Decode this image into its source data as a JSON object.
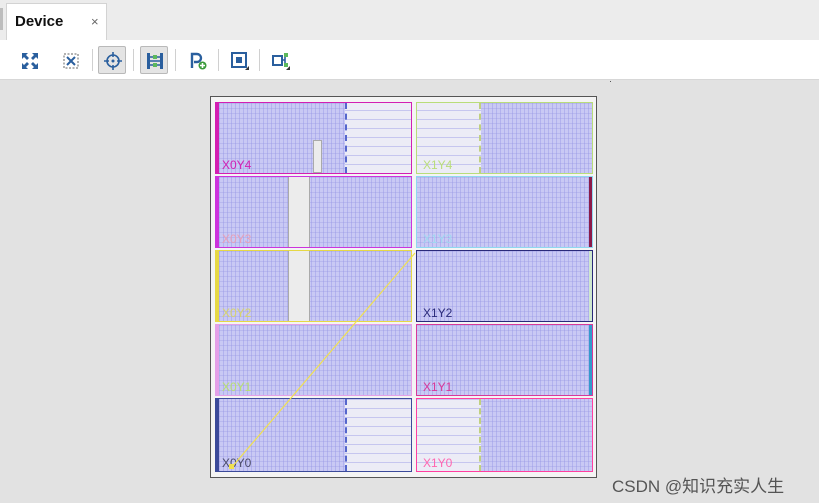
{
  "tab": {
    "title": "Device",
    "close_glyph": "×"
  },
  "toolbar": {
    "buttons": [
      {
        "name": "auto-fit-selection-button",
        "icon": "expand-arrows-icon",
        "active": false
      },
      {
        "name": "fit-selection-button",
        "icon": "fit-selection-icon",
        "active": false
      },
      {
        "name": "show-cell-button",
        "icon": "crosshair-icon",
        "active": true
      },
      {
        "name": "routing-resources-button",
        "icon": "routing-resources-icon",
        "active": true
      },
      {
        "name": "create-pblock-button",
        "icon": "pblock-add-icon",
        "active": false
      },
      {
        "name": "draw-pblock-button",
        "icon": "square-frame-icon",
        "active": false
      },
      {
        "name": "show-nets-button",
        "icon": "net-connect-icon",
        "active": false
      }
    ]
  },
  "device": {
    "regions": [
      {
        "id": "X0Y4",
        "color": "#d31fb3",
        "label_color": "#d31fb3"
      },
      {
        "id": "X1Y4",
        "color": "#b9dd7a",
        "label_color": "#b9dd7a"
      },
      {
        "id": "X0Y3",
        "color": "#cc33dd",
        "label_color": "#e8a0b8"
      },
      {
        "id": "X1Y3",
        "color": "#8fd8f0",
        "label_color": "#9fd8f0"
      },
      {
        "id": "X0Y2",
        "color": "#e6d845",
        "label_color": "#d8d46a"
      },
      {
        "id": "X1Y2",
        "color": "#2a2a7a",
        "label_color": "#2a2a7a"
      },
      {
        "id": "X0Y1",
        "color": "#e4a0e8",
        "label_color": "#b8e070"
      },
      {
        "id": "X1Y1",
        "color": "#d8389a",
        "label_color": "#d8389a"
      },
      {
        "id": "X0Y0",
        "color": "#3b4a9a",
        "label_color": "#4a4a6a"
      },
      {
        "id": "X1Y0",
        "color": "#ff3fa0",
        "label_color": "#ff66b0"
      }
    ],
    "net_color": "#f0e050"
  },
  "watermark": "CSDN @知识充实人生"
}
